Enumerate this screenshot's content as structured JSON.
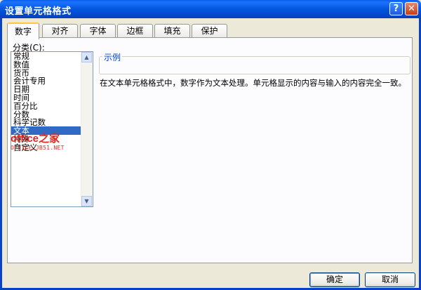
{
  "window": {
    "title": "设置单元格格式",
    "help_label": "?",
    "close_label": "✕"
  },
  "tabs": [
    {
      "label": "数字",
      "active": true
    },
    {
      "label": "对齐"
    },
    {
      "label": "字体"
    },
    {
      "label": "边框"
    },
    {
      "label": "填充"
    },
    {
      "label": "保护"
    }
  ],
  "category": {
    "label": "分类(C):",
    "items": [
      "常规",
      "数值",
      "货币",
      "会计专用",
      "日期",
      "时间",
      "百分比",
      "分数",
      "科学记数",
      "文本",
      "特殊",
      "自定义"
    ],
    "selected": "文本"
  },
  "sample": {
    "legend": "示例",
    "value": ""
  },
  "description": "在文本单元格格式中，数字作为文本处理。单元格显示的内容与输入的内容完全一致。",
  "watermark": {
    "main": "office之家",
    "sub": "OFFICE.JB51.NET"
  },
  "buttons": {
    "ok": "确定",
    "cancel": "取消"
  },
  "icons": {
    "scroll_up": "▲",
    "scroll_down": "▼"
  }
}
